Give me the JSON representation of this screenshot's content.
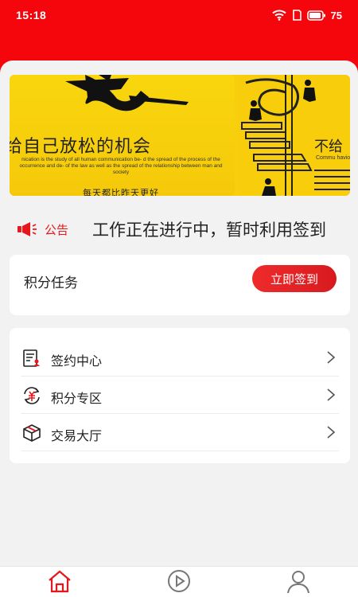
{
  "status_bar": {
    "time": "15:18",
    "battery": "75"
  },
  "banner": {
    "slide1": {
      "title": "给自己放松的机会",
      "body": "nication is the study of all human communication be- d the spread of the process of the occurrence and de- of the law as well as the spread of the relationship between man and society",
      "subtitle": "每天都比昨天更好"
    },
    "slide2": {
      "title": "不给",
      "body": "Commu havior an velopme"
    }
  },
  "notice": {
    "label": "公告",
    "text": "工作正在进行中，暂时利用签到"
  },
  "task": {
    "title": "积分任务",
    "button_label": "立即签到"
  },
  "menu": {
    "items": [
      {
        "label": "签约中心",
        "icon": "contract-icon"
      },
      {
        "label": "积分专区",
        "icon": "points-icon"
      },
      {
        "label": "交易大厅",
        "icon": "box-icon"
      }
    ]
  },
  "tabbar": {
    "items": [
      {
        "label": "首页",
        "icon": "home-icon",
        "active": true
      },
      {
        "label": "视频",
        "icon": "play-icon",
        "active": false
      },
      {
        "label": "我的",
        "icon": "user-icon",
        "active": false
      }
    ]
  },
  "colors": {
    "brand_red": "#f5060c",
    "button_red": "#e0222a",
    "banner_yellow": "#f7cd0c"
  }
}
